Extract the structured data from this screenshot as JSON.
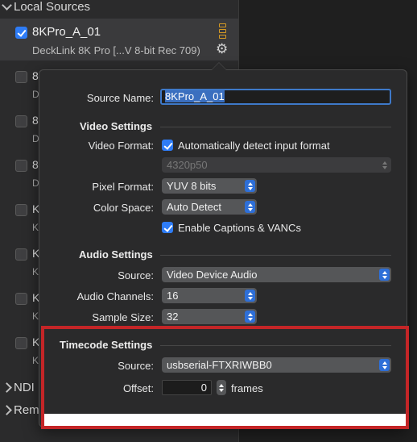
{
  "sidebar": {
    "local_sources_label": "Local Sources",
    "selected_source": {
      "name": "8KPro_A_01",
      "description": "DeckLink 8K Pro [...V 8-bit Rec 709)",
      "checked": true
    },
    "list_rows": [
      {
        "letter": "8",
        "sub": "D"
      },
      {
        "letter": "8",
        "sub": "D"
      },
      {
        "letter": "8",
        "sub": "D"
      },
      {
        "letter": "K",
        "sub": "K"
      },
      {
        "letter": "K",
        "sub": "K"
      },
      {
        "letter": "K",
        "sub": "K"
      },
      {
        "letter": "K",
        "sub": "K"
      }
    ],
    "ndi_label": "NDI",
    "remote_label": "Rem"
  },
  "popover": {
    "source_name_label": "Source Name:",
    "source_name_value": "8KPro_A_01",
    "video_settings_heading": "Video Settings",
    "video_format_label": "Video Format:",
    "auto_detect_label": "Automatically detect input format",
    "format_value": "4320p50",
    "pixel_format_label": "Pixel Format:",
    "pixel_format_value": "YUV 8 bits",
    "color_space_label": "Color Space:",
    "color_space_value": "Auto Detect",
    "captions_label": "Enable Captions & VANCs",
    "audio_settings_heading": "Audio Settings",
    "audio_source_label": "Source:",
    "audio_source_value": "Video Device Audio",
    "audio_channels_label": "Audio Channels:",
    "audio_channels_value": "16",
    "sample_size_label": "Sample Size:",
    "sample_size_value": "32",
    "timecode_settings_heading": "Timecode Settings",
    "timecode_source_label": "Source:",
    "timecode_source_value": "usbserial-FTXRIWBB0",
    "offset_label": "Offset:",
    "offset_value": "0",
    "frames_label": "frames"
  },
  "colors": {
    "accent": "#2e7cf6",
    "highlight_border": "#c42527",
    "level_meter": "#d79b24"
  }
}
